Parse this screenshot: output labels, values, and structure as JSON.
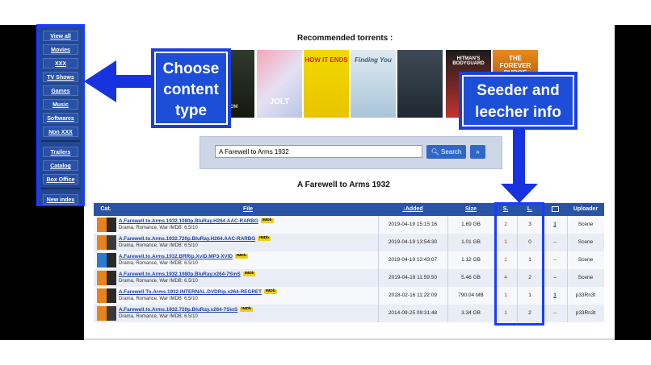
{
  "sidebar": {
    "items": [
      {
        "label": "View all"
      },
      {
        "label": "Movies"
      },
      {
        "label": "XXX"
      },
      {
        "label": "TV Shows"
      },
      {
        "label": "Games"
      },
      {
        "label": "Music"
      },
      {
        "label": "Softwares"
      },
      {
        "label": "Non XXX"
      },
      {
        "label": "Trailers"
      },
      {
        "label": "Catalog"
      },
      {
        "label": "Box Office"
      },
      {
        "label": "New index"
      }
    ]
  },
  "recommended": {
    "title": "Recommended torrents :",
    "posters": [
      {
        "caption": "DOM"
      },
      {
        "caption": "JOLT"
      },
      {
        "caption": "HOW IT ENDS"
      },
      {
        "caption": "Finding You"
      },
      {
        "caption": ""
      },
      {
        "caption": "HITMAN'S BODYGUARD"
      },
      {
        "caption": "THE FOREVER PURGE"
      }
    ]
  },
  "callouts": {
    "content_type": "Choose content type",
    "seeder_info": "Seeder and leecher info"
  },
  "search": {
    "value": "A Farewell to Arms 1932",
    "button_label": "Search",
    "more_label": "»"
  },
  "results": {
    "title": "A Farewell to Arms 1932",
    "headers": {
      "cat": "Cat.",
      "file": "File",
      "added": "Added",
      "size": "Size",
      "seeders": "S.",
      "leechers": "L.",
      "comments": "",
      "uploader": "Uploader"
    },
    "rows": [
      {
        "name": "A.Farewell.to.Arms.1932.1080p.BluRay.H264.AAC-RARBG",
        "meta": "Drama, Romance, War IMDB: 6.5/10",
        "added": "2019-04-19 15:15:16",
        "size": "1.69 GB",
        "seeders": "2",
        "leechers": "3",
        "comments": "1",
        "uploader": "Scene",
        "quality": "1080p"
      },
      {
        "name": "A.Farewell.to.Arms.1932.720p.BluRay.H264.AAC-RARBG",
        "meta": "Drama, Romance, War IMDB: 6.5/10",
        "added": "2019-04-19 13:54:30",
        "size": "1.01 GB",
        "seeders": "1",
        "leechers": "0",
        "comments": "--",
        "uploader": "Scene",
        "quality": "720p"
      },
      {
        "name": "A.Farewell.to.Arms.1932.BRRip.XviD.MP3-XVID",
        "meta": "Drama, Romance, War IMDB: 6.5/10",
        "added": "2019-04-19 12:43:07",
        "size": "1.12 GB",
        "seeders": "1",
        "leechers": "1",
        "comments": "--",
        "uploader": "Scene",
        "quality": "XviD"
      },
      {
        "name": "A.Farewell.to.Arms.1932.1080p.BluRay.x264-7SinS",
        "meta": "Drama, Romance, War IMDB: 6.5/10",
        "added": "2019-04-19 11:59:50",
        "size": "5.46 GB",
        "seeders": "4",
        "leechers": "2",
        "comments": "--",
        "uploader": "Scene",
        "quality": "1080p"
      },
      {
        "name": "A.Farewell.To.Arms.1932.INTERNAL.DVDRip.x264-REGRET",
        "meta": "Drama, Romance, War IMDB: 6.5/10",
        "added": "2018-02-16 11:22:09",
        "size": "790.04 MB",
        "seeders": "1",
        "leechers": "1",
        "comments": "1",
        "uploader": "p33Rn3t",
        "quality": "x264"
      },
      {
        "name": "A.Farewell.to.Arms.1932.720p.BluRay.x264-7SinS",
        "meta": "Drama, Romance, War IMDB: 6.5/10",
        "added": "2014-09-25 09:31:48",
        "size": "3.34 GB",
        "seeders": "1",
        "leechers": "2",
        "comments": "--",
        "uploader": "p33Rn3t",
        "quality": "720p"
      }
    ],
    "imdb_badge": "IMDb"
  },
  "colors": {
    "header_blue": "#2853a6",
    "callout_blue": "#1d4ed8",
    "seeder_red": "#d62020"
  }
}
